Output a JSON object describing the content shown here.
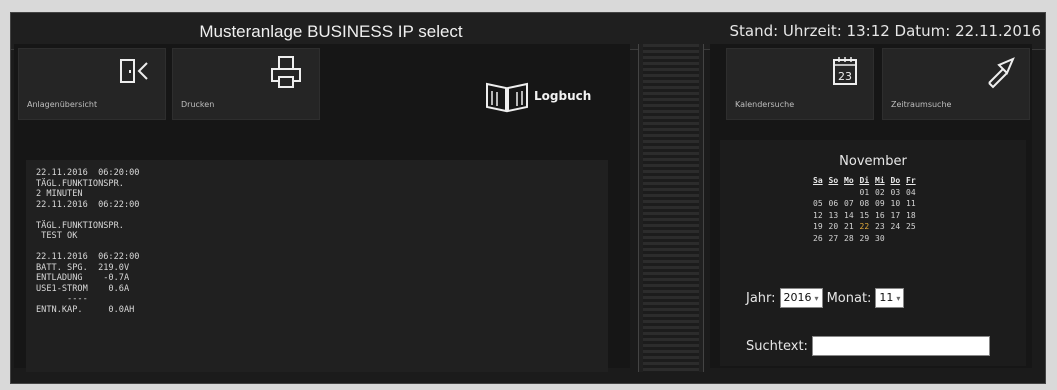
{
  "header": {
    "title": "Musteranlage BUSINESS IP select",
    "status": "Stand: Uhrzeit: 13:12  Datum: 22.11.2016"
  },
  "toolbar": {
    "anlagenuebersicht_label": "Anlagenübersicht",
    "drucken_label": "Drucken",
    "logbuch_label": "Logbuch",
    "kalendersuche_label": "Kalendersuche",
    "zeitraumsuche_label": "Zeitraumsuche",
    "calendar_icon_day": "23"
  },
  "log": {
    "text": "22.11.2016  06:20:00\nTÄGL.FUNKTIONSPR.\n2 MINUTEN\n22.11.2016  06:22:00\n\nTÄGL.FUNKTIONSPR.\n TEST OK\n\n22.11.2016  06:22:00\nBATT. SPG.  219.0V\nENTLADUNG    -0.7A\nUSE1-STROM    0.6A\n      ----\nENTN.KAP.     0.0AH"
  },
  "calendar": {
    "month": "November",
    "weekdays": [
      "Sa",
      "So",
      "Mo",
      "Di",
      "Mi",
      "Do",
      "Fr"
    ],
    "weeks": [
      [
        "",
        "",
        "",
        "",
        "01",
        "02",
        "03",
        "04"
      ],
      [
        "05",
        "06",
        "07",
        "08",
        "09",
        "10",
        "11"
      ],
      [
        "12",
        "13",
        "14",
        "15",
        "16",
        "17",
        "18"
      ],
      [
        "19",
        "20",
        "21",
        "22",
        "23",
        "24",
        "25"
      ],
      [
        "26",
        "27",
        "28",
        "29",
        "30",
        "",
        ""
      ]
    ],
    "today": "22",
    "jahr_label": "Jahr:",
    "jahr_value": "2016",
    "monat_label": "Monat:",
    "monat_value": "11",
    "suchtext_label": "Suchtext:",
    "suchtext_value": ""
  },
  "colors": {
    "background": "#1b1b1b",
    "highlight": "#e0a93a"
  }
}
